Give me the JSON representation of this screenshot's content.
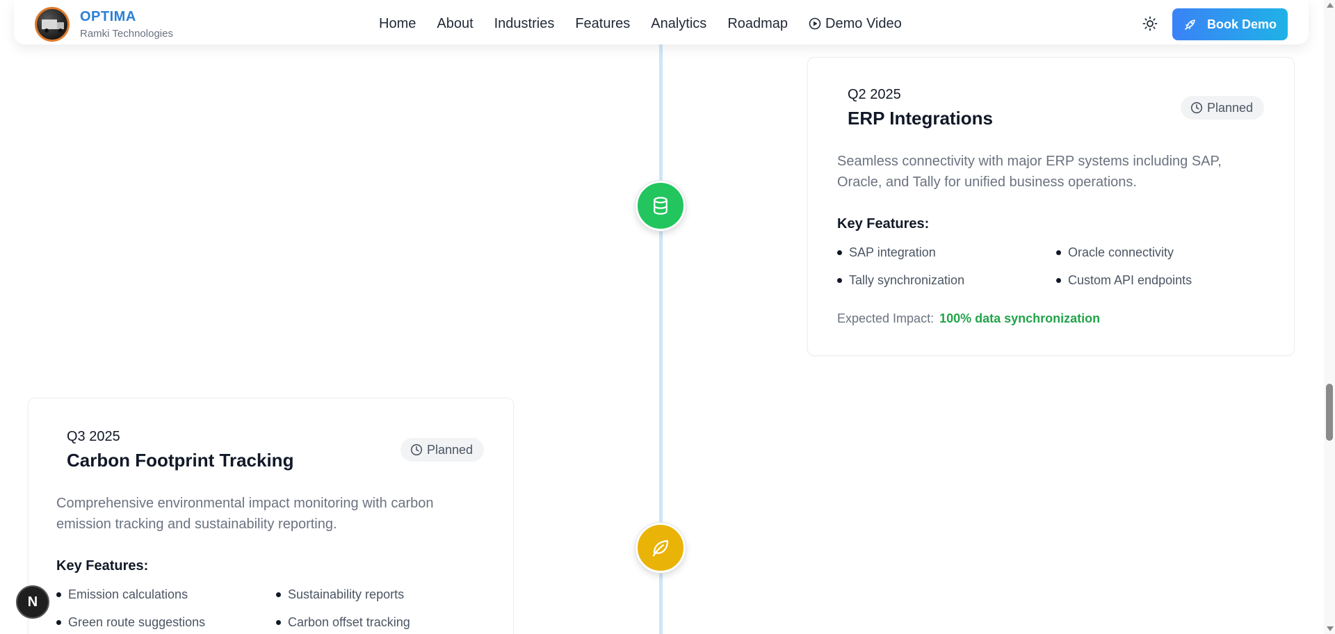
{
  "header": {
    "brand_name": "OPTIMA",
    "brand_sub": "Ramki Technologies",
    "nav": [
      "Home",
      "About",
      "Industries",
      "Features",
      "Analytics",
      "Roadmap",
      "Demo Video"
    ],
    "book_demo": "Book Demo"
  },
  "cards": {
    "erp": {
      "quarter": "Q2 2025",
      "title": "ERP Integrations",
      "status": "Planned",
      "description_line1": "Seamless connectivity with major ERP systems including SAP,",
      "description_line2": "Oracle, and Tally for unified business operations.",
      "key_features_title": "Key Features:",
      "features": [
        "SAP integration",
        "Oracle connectivity",
        "Tally synchronization",
        "Custom API endpoints"
      ],
      "impact_label": "Expected Impact:",
      "impact_value": "100% data synchronization",
      "icon": "database-icon",
      "color": "#22c55e"
    },
    "carbon": {
      "quarter": "Q3 2025",
      "title": "Carbon Footprint Tracking",
      "status": "Planned",
      "description_line1": "Comprehensive environmental impact monitoring with carbon",
      "description_line2": "emission tracking and sustainability reporting.",
      "key_features_title": "Key Features:",
      "features": [
        "Emission calculations",
        "Sustainability reports",
        "Green route suggestions",
        "Carbon offset tracking"
      ],
      "icon": "leaf-icon",
      "color": "#eab308"
    }
  },
  "next_badge": "N",
  "colors": {
    "accent_blue": "#3b82f6",
    "impact_green": "#22a34a",
    "timeline": "#cfe6f8"
  }
}
